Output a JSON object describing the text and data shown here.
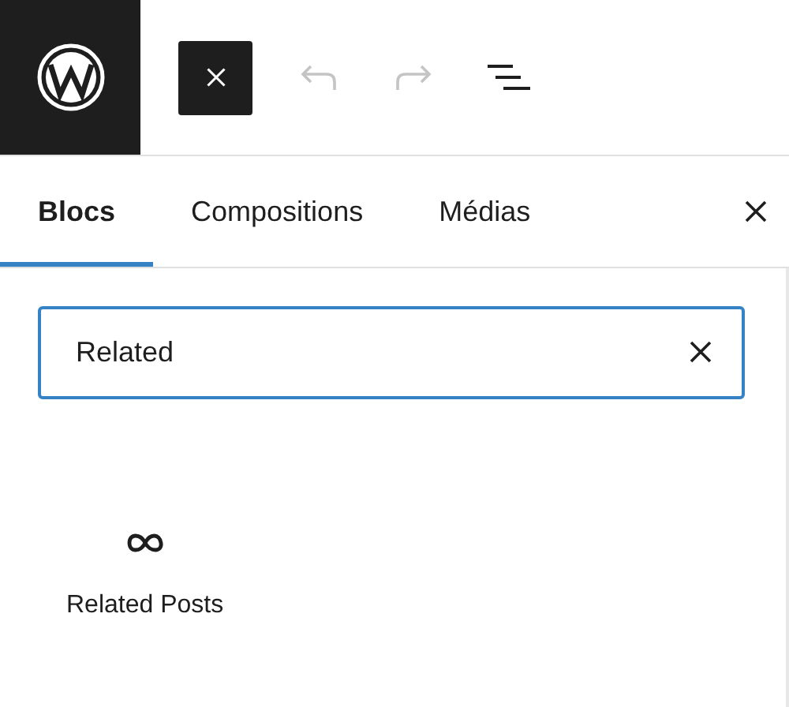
{
  "toolbar": {
    "history": [
      {
        "kind": "undo",
        "disabled": true
      },
      {
        "kind": "redo",
        "disabled": true
      }
    ]
  },
  "tabs": [
    {
      "label": "Blocs",
      "selected": true
    },
    {
      "label": "Compositions",
      "selected": false
    },
    {
      "label": "Médias",
      "selected": false
    }
  ],
  "search": {
    "value": "Related"
  },
  "results": [
    {
      "label": "Related Posts"
    }
  ]
}
